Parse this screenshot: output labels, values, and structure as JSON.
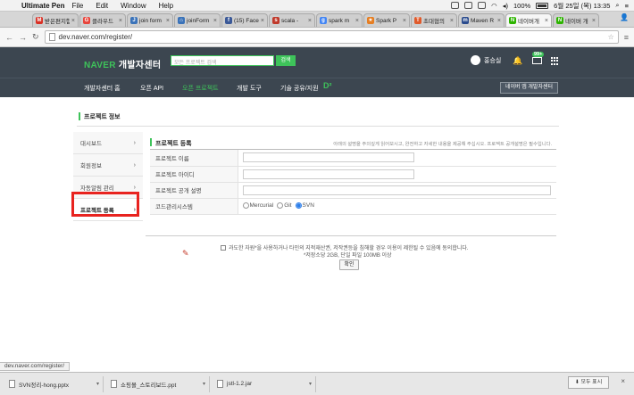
{
  "system_menubar": {
    "app_name": "Ultimate Pen",
    "menus": [
      "File",
      "Edit",
      "Window",
      "Help"
    ],
    "battery": "100%",
    "datetime": "6월 25일 (목)  13:35"
  },
  "browser": {
    "tabs": [
      {
        "label": "받은편지함",
        "icon": "gmail-icon",
        "color": "#d93025",
        "glyph": "M"
      },
      {
        "label": "클라우드",
        "icon": "google-icon",
        "color": "#e8453c",
        "glyph": "G"
      },
      {
        "label": "join form",
        "icon": "page-icon",
        "color": "#3b73b9",
        "glyph": "J"
      },
      {
        "label": "joinForm",
        "icon": "home-icon",
        "color": "#3b73b9",
        "glyph": "⌂"
      },
      {
        "label": "(15) Face",
        "icon": "facebook-icon",
        "color": "#3b5998",
        "glyph": "f"
      },
      {
        "label": "scala - ",
        "icon": "scala-icon",
        "color": "#c0392b",
        "glyph": "s"
      },
      {
        "label": "spark m",
        "icon": "google-icon",
        "color": "#4285f4",
        "glyph": "g"
      },
      {
        "label": "Spark P",
        "icon": "spark-icon",
        "color": "#e67e22",
        "glyph": "★"
      },
      {
        "label": "초대협의",
        "icon": "circle-icon",
        "color": "#e05a2b",
        "glyph": "T"
      },
      {
        "label": "Maven R",
        "icon": "maven-icon",
        "color": "#2a4b8d",
        "glyph": "m"
      },
      {
        "label": "네이버개",
        "icon": "naver-icon",
        "color": "#2db400",
        "glyph": "N"
      },
      {
        "label": "네이버 개",
        "icon": "naver-icon",
        "color": "#2db400",
        "glyph": "N"
      }
    ],
    "url": "dev.naver.com/register/",
    "status_url": "dev.naver.com/register/"
  },
  "naver": {
    "logo_brand": "NAVER",
    "logo_text": " 개발자센터",
    "search_placeholder": "모든 프로젝트 검색",
    "search_button": "검색",
    "user_name": "홍승실",
    "mail_badge": "99+",
    "nav": [
      {
        "label": "개발자센터 홈",
        "active": false
      },
      {
        "label": "오픈 API",
        "active": false
      },
      {
        "label": "오픈 프로젝트",
        "active": true
      },
      {
        "label": "개발 도구",
        "active": false
      },
      {
        "label": "기술 공유/지원",
        "active": false
      }
    ],
    "d2_label": "D²",
    "app_center_button": "네이버 앱 개발자센터"
  },
  "page": {
    "title": "프로젝트 정보",
    "side_menu": [
      {
        "label": "대시보드",
        "selected": false
      },
      {
        "label": "회원정보",
        "selected": false
      },
      {
        "label": "자동알림 관리",
        "selected": false
      },
      {
        "label": "프로젝트 등록",
        "selected": true
      }
    ],
    "section_title": "프로젝트 등록",
    "section_note": "아래의 설명을 주의깊게 읽어보시고, 완전하고 자세한 내용을 제공해 주십시오. 프로젝트 공개설명은 필수입니다.",
    "form": {
      "name_label": "프로젝트 이름",
      "name_value": "",
      "id_label": "프로젝트 아이디",
      "id_value": "",
      "desc_label": "프로젝트 공개 설명",
      "desc_value": "",
      "vcs_label": "코드관리시스템",
      "vcs_options": [
        "Mercurial",
        "Git",
        "SVN"
      ],
      "vcs_selected": "SVN"
    },
    "agree_text": "과도한 자원*을 사용하거나 타인의 지적재산권, 저작권등을 침해할 경우 이용이 제한될 수 있음에 동의합니다.",
    "agree_sub": "*저장소당 2GB, 단일 파일 100MB 이상",
    "confirm_button": "확인"
  },
  "downloads": {
    "items": [
      "SVN정리-hong.pptx",
      "쇼핑몰_스토리보드.ppt",
      "jstl-1.2.jar"
    ],
    "show_all": "모두 표시"
  }
}
